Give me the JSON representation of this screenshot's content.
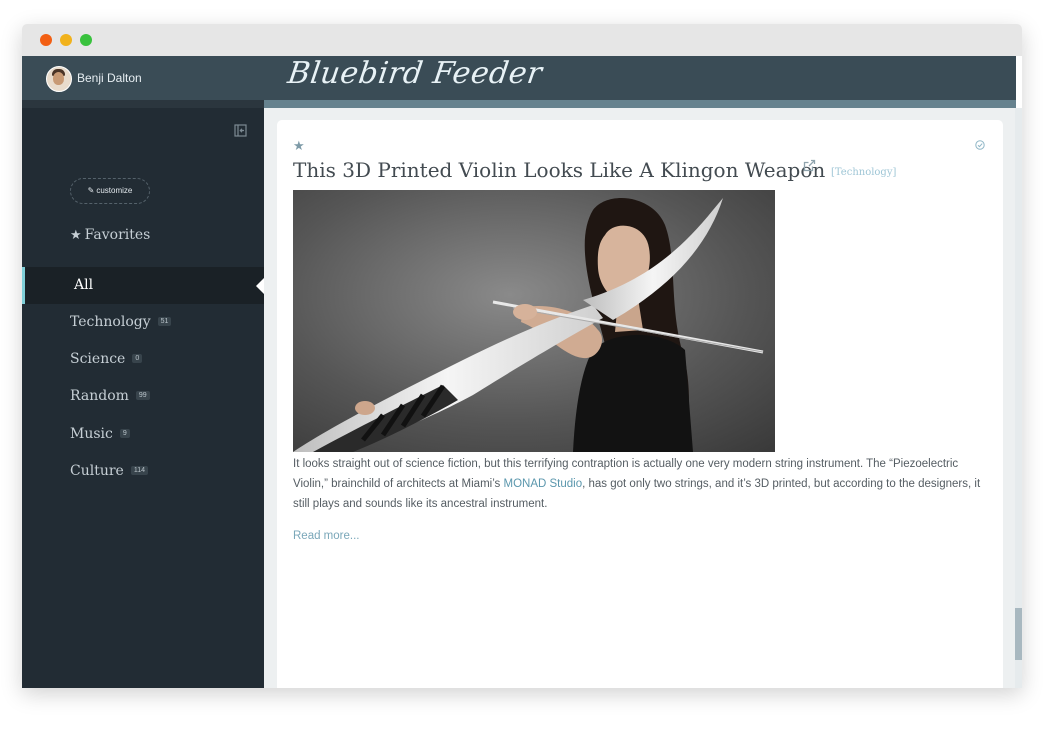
{
  "window": {
    "controls": [
      "close",
      "minimize",
      "maximize"
    ]
  },
  "user": {
    "name": "Benji Dalton",
    "avatar": "avatar-icon"
  },
  "sidebar": {
    "customize_label": "customize",
    "collapse_icon": "collapse-sidebar-icon",
    "items": [
      {
        "label": "Favorites",
        "icon": "star-icon",
        "count": null,
        "active": false
      },
      {
        "label": "All",
        "count": null,
        "active": true
      },
      {
        "label": "Technology",
        "count": "51",
        "active": false
      },
      {
        "label": "Science",
        "count": "0",
        "active": false
      },
      {
        "label": "Random",
        "count": "99",
        "active": false
      },
      {
        "label": "Music",
        "count": "9",
        "active": false
      },
      {
        "label": "Culture",
        "count": "114",
        "active": false
      }
    ]
  },
  "header": {
    "brand": "Bluebird Feeder"
  },
  "article": {
    "title": "This 3D Printed Violin Looks Like A Klingon Weapon",
    "tag": "[Technology]",
    "body_before_link": "It looks straight out of science fiction, but this terrifying contraption is actually one very modern string instrument. The “Piezoelectric Violin,” brainchild of architects at Miami’s ",
    "link_text": "MONAD Studio",
    "body_after_link": ", has got only two strings, and it’s 3D printed, but according to the designers, it still plays and sounds like its ancestral instrument.",
    "read_more": "Read more..."
  },
  "colors": {
    "sidebar_bg": "#222c34",
    "header_bg": "#3a4c56",
    "accent": "#7fcfd8",
    "link": "#5b97ad"
  }
}
